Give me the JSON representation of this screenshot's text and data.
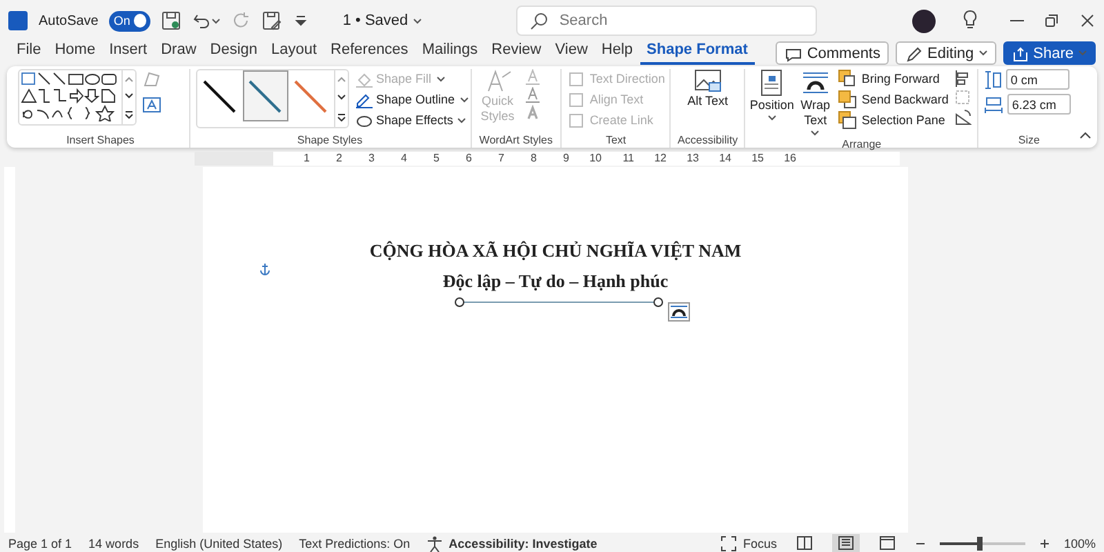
{
  "title_bar": {
    "autosave": {
      "label": "AutoSave",
      "toggle_label": "On",
      "on": true
    },
    "document_status": "1 • Saved",
    "search": {
      "placeholder": "Search"
    }
  },
  "tabs": [
    {
      "label": "File",
      "selected": false
    },
    {
      "label": "Home",
      "selected": false
    },
    {
      "label": "Insert",
      "selected": false
    },
    {
      "label": "Draw",
      "selected": false
    },
    {
      "label": "Design",
      "selected": false
    },
    {
      "label": "Layout",
      "selected": false
    },
    {
      "label": "References",
      "selected": false
    },
    {
      "label": "Mailings",
      "selected": false
    },
    {
      "label": "Review",
      "selected": false
    },
    {
      "label": "View",
      "selected": false
    },
    {
      "label": "Help",
      "selected": false
    },
    {
      "label": "Shape Format",
      "selected": true
    }
  ],
  "header_buttons": [
    {
      "kind": "comments",
      "label": "Comments"
    },
    {
      "kind": "editing",
      "label": "Editing"
    },
    {
      "kind": "share",
      "label": "Share"
    }
  ],
  "ribbon": {
    "insert_shapes": {
      "label": "Insert Shapes"
    },
    "shape_styles": {
      "label": "Shape Styles",
      "presets": [
        {
          "color": "#111111",
          "selected": false
        },
        {
          "color": "#2f6f8f",
          "selected": true
        },
        {
          "color": "#e07040",
          "selected": false
        }
      ],
      "commands": [
        {
          "label": "Shape Fill",
          "disabled": true
        },
        {
          "label": "Shape Outline",
          "disabled": false
        },
        {
          "label": "Shape Effects",
          "disabled": false
        }
      ]
    },
    "wordart_styles": {
      "label": "WordArt Styles",
      "quick_styles": {
        "label": "Quick Styles",
        "disabled": true
      }
    },
    "text": {
      "label": "Text",
      "commands": [
        {
          "label": "Text Direction",
          "disabled": true
        },
        {
          "label": "Align Text",
          "disabled": true
        },
        {
          "label": "Create Link",
          "disabled": true
        }
      ]
    },
    "accessibility": {
      "label": "Accessibility",
      "alt_text": "Alt Text"
    },
    "arrange": {
      "label": "Arrange",
      "large": [
        {
          "kind": "position",
          "label": "Position"
        },
        {
          "kind": "wrap",
          "label": "Wrap Text"
        }
      ],
      "commands": [
        {
          "kind": "forward",
          "label": "Bring Forward"
        },
        {
          "kind": "backward",
          "label": "Send Backward"
        },
        {
          "kind": "pane",
          "label": "Selection Pane"
        }
      ]
    },
    "size": {
      "label": "Size",
      "height": "0 cm",
      "width": "6.23 cm"
    }
  },
  "ruler": {
    "numbers": [
      "1",
      "2",
      "3",
      "4",
      "5",
      "6",
      "7",
      "8",
      "9",
      "10",
      "11",
      "12",
      "13",
      "14",
      "15",
      "16"
    ]
  },
  "document": {
    "lines": [
      "CỘNG HÒA XÃ HỘI CHỦ NGHĨA VIỆT NAM",
      "Độc lập – Tự do – Hạnh phúc"
    ]
  },
  "status_bar": {
    "items": [
      "Page 1 of 1",
      "14 words",
      "English (United States)",
      "Text Predictions: On"
    ],
    "accessibility": "Accessibility: Investigate",
    "focus": "Focus",
    "views": [
      {
        "kind": "read",
        "selected": false
      },
      {
        "kind": "print",
        "selected": true
      },
      {
        "kind": "web",
        "selected": false
      }
    ],
    "zoom": {
      "level": 0.5,
      "label": "100%"
    }
  }
}
